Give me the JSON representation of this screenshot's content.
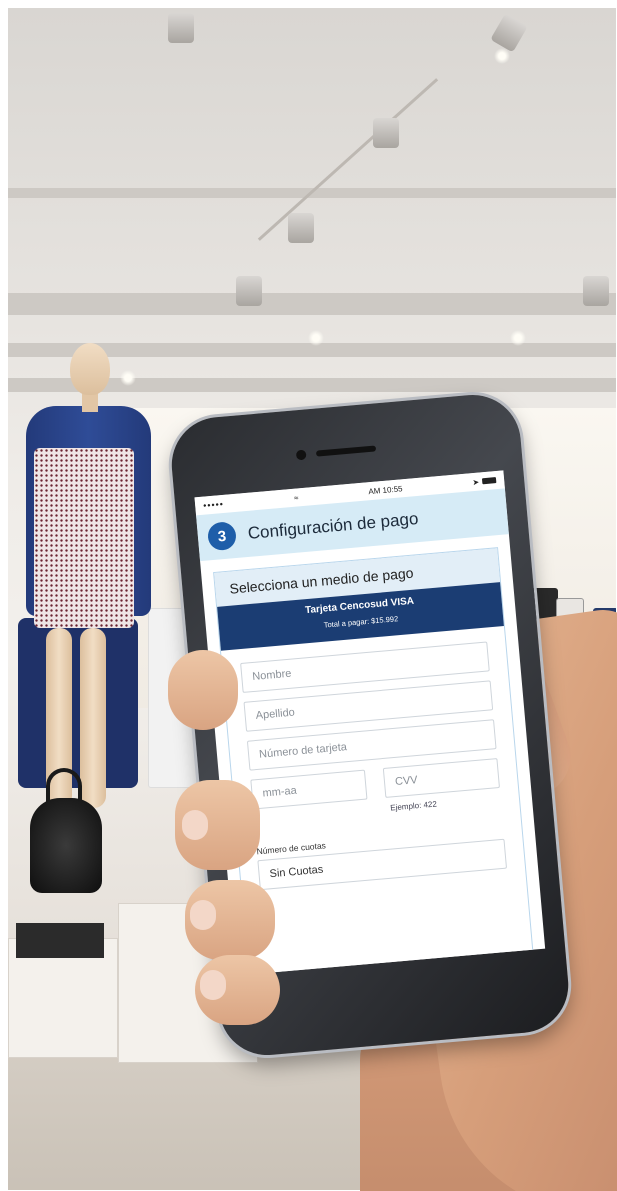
{
  "statusbar": {
    "signal": "•••••",
    "time": "AM 10:55"
  },
  "header": {
    "step": "3",
    "title": "Configuración de pago"
  },
  "payment": {
    "section_title": "Selecciona un medio de pago",
    "method_name": "Tarjeta Cencosud VISA",
    "total": "Total a pagar: $15.992"
  },
  "form": {
    "first_name_placeholder": "Nombre",
    "last_name_placeholder": "Apellido",
    "card_number_placeholder": "Número de tarjeta",
    "expiry_placeholder": "mm-aa",
    "cvv_placeholder": "CVV",
    "cvv_hint": "Ejemplo: 422",
    "installments_label": "Número de cuotas",
    "installments_value": "Sin Cuotas"
  },
  "colors": {
    "accent": "#1e5ea9",
    "method_bar": "#1b3d73",
    "header_bg": "#d6ebf6"
  }
}
